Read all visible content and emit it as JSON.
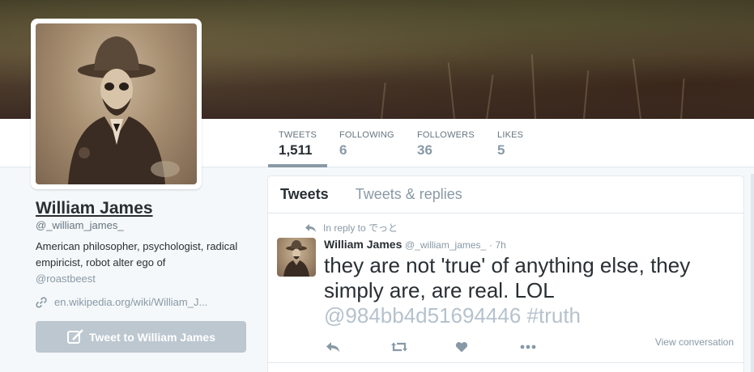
{
  "nav": {
    "items": [
      {
        "label": "TWEETS",
        "value": "1,511"
      },
      {
        "label": "FOLLOWING",
        "value": "6"
      },
      {
        "label": "FOLLOWERS",
        "value": "36"
      },
      {
        "label": "LIKES",
        "value": "5"
      }
    ]
  },
  "profile": {
    "name": "William James",
    "handle": "@_william_james_",
    "bio": "American philosopher, psychologist, radical empiricist, robot alter ego of",
    "bio_mention": "@roastbeest",
    "website": "en.wikipedia.org/wiki/William_J...",
    "tweet_to_label": "Tweet to William James"
  },
  "timeline": {
    "tabs": [
      "Tweets",
      "Tweets & replies"
    ],
    "tweet": {
      "reply_context_prefix": "In reply to",
      "reply_context_name": "でっと",
      "author_name": "William James",
      "author_handle": "@_william_james_",
      "separator": "·",
      "time": "7h",
      "text": "they are not 'true' of anything else, they simply are, are real. LOL",
      "text_tags": "@984bb4d51694446 #truth",
      "view_conversation": "View conversation"
    }
  },
  "colors": {
    "accent": "#8899a6",
    "text": "#292f33",
    "muted": "#66757f",
    "button_disabled": "#bcc7d0"
  }
}
